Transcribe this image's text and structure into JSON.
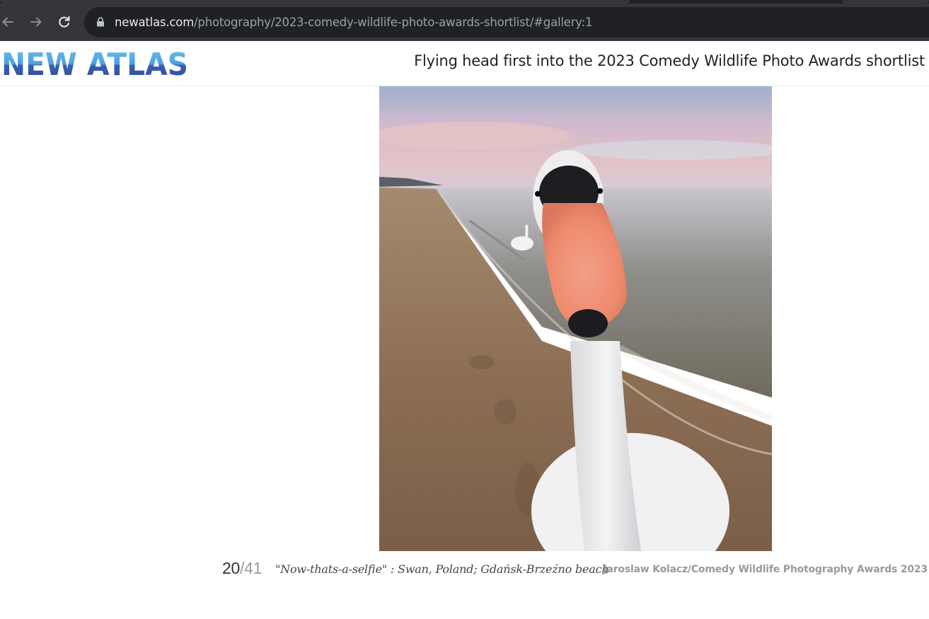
{
  "browser": {
    "back_icon": "arrow-left-icon",
    "forward_icon": "arrow-right-icon",
    "reload_icon": "reload-icon",
    "lock_icon": "lock-icon",
    "url_host": "newatlas.com",
    "url_path": "/photography/2023-comedy-wildlife-photo-awards-shortlist/#gallery:1"
  },
  "header": {
    "logo_text": "NEW ATLAS",
    "article_title": "Flying head first into the 2023 Comedy Wildlife Photo Awards shortlist"
  },
  "gallery": {
    "current": "20",
    "separator": "/",
    "total": "41",
    "caption": "\"Now-thats-a-selfie\" : Swan, Poland; Gdańsk-Brzeźno beach",
    "credit": "Jaroslaw Kolacz/Comedy Wildlife Photography Awards 2023"
  },
  "colors": {
    "chrome_bg": "#35363a",
    "omnibox_bg": "#202124",
    "logo_light": "#5bb0e8",
    "logo_dark": "#2f4fa0"
  }
}
